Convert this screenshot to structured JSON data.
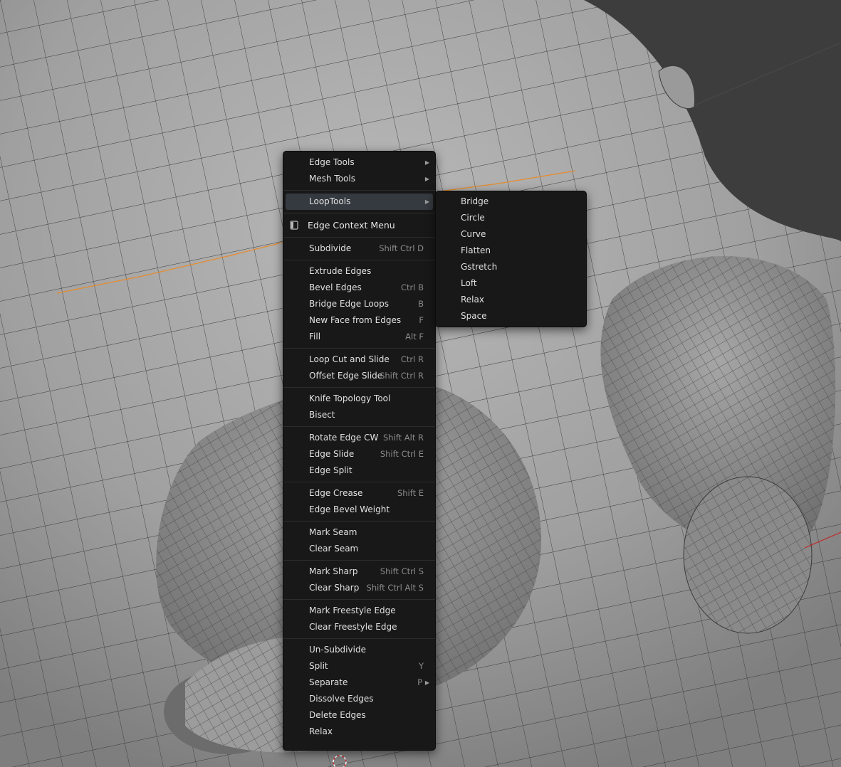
{
  "main_menu": {
    "group_tools": [
      {
        "label": "Edge Tools",
        "has_submenu": true
      },
      {
        "label": "Mesh Tools",
        "has_submenu": true
      }
    ],
    "looptools": {
      "label": "LoopTools",
      "has_submenu": true
    },
    "title": "Edge Context Menu",
    "groups": [
      [
        {
          "label": "Subdivide",
          "shortcut": "Shift Ctrl D"
        }
      ],
      [
        {
          "label": "Extrude Edges",
          "shortcut": ""
        },
        {
          "label": "Bevel Edges",
          "shortcut": "Ctrl B"
        },
        {
          "label": "Bridge Edge Loops",
          "shortcut": "B"
        },
        {
          "label": "New Face from Edges",
          "shortcut": "F"
        },
        {
          "label": "Fill",
          "shortcut": "Alt F"
        }
      ],
      [
        {
          "label": "Loop Cut and Slide",
          "shortcut": "Ctrl R"
        },
        {
          "label": "Offset Edge Slide",
          "shortcut": "Shift Ctrl R"
        }
      ],
      [
        {
          "label": "Knife Topology Tool",
          "shortcut": ""
        },
        {
          "label": "Bisect",
          "shortcut": ""
        }
      ],
      [
        {
          "label": "Rotate Edge CW",
          "shortcut": "Shift Alt R"
        },
        {
          "label": "Edge Slide",
          "shortcut": "Shift Ctrl E"
        },
        {
          "label": "Edge Split",
          "shortcut": ""
        }
      ],
      [
        {
          "label": "Edge Crease",
          "shortcut": "Shift E"
        },
        {
          "label": "Edge Bevel Weight",
          "shortcut": ""
        }
      ],
      [
        {
          "label": "Mark Seam",
          "shortcut": ""
        },
        {
          "label": "Clear Seam",
          "shortcut": ""
        }
      ],
      [
        {
          "label": "Mark Sharp",
          "shortcut": "Shift Ctrl S"
        },
        {
          "label": "Clear Sharp",
          "shortcut": "Shift Ctrl Alt S"
        }
      ],
      [
        {
          "label": "Mark Freestyle Edge",
          "shortcut": ""
        },
        {
          "label": "Clear Freestyle Edge",
          "shortcut": ""
        }
      ],
      [
        {
          "label": "Un-Subdivide",
          "shortcut": ""
        },
        {
          "label": "Split",
          "shortcut": "Y"
        },
        {
          "label": "Separate",
          "shortcut": "P",
          "has_submenu": true
        },
        {
          "label": "Dissolve Edges",
          "shortcut": ""
        },
        {
          "label": "Delete Edges",
          "shortcut": ""
        },
        {
          "label": "Relax",
          "shortcut": ""
        }
      ]
    ]
  },
  "looptools_submenu": {
    "items": [
      "Bridge",
      "Circle",
      "Curve",
      "Flatten",
      "Gstretch",
      "Loft",
      "Relax",
      "Space"
    ]
  },
  "colors": {
    "menu_bg": "#181818",
    "highlight": "#353a40",
    "selected_edge": "#e88a2a",
    "axis_x": "#c22a2a",
    "viewport_bg": "#3d3d3d"
  }
}
